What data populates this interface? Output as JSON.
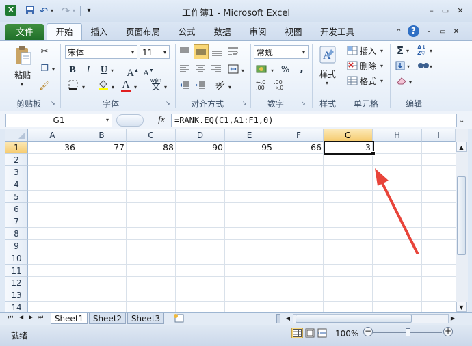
{
  "title": "工作簿1 - Microsoft Excel",
  "window": {
    "minimize": "–",
    "restore": "▭",
    "close": "✕"
  },
  "quick_access": {
    "undo": "↶",
    "redo": "↷",
    "customize": "▾"
  },
  "tabs": [
    {
      "label": "文件"
    },
    {
      "label": "开始"
    },
    {
      "label": "插入"
    },
    {
      "label": "页面布局"
    },
    {
      "label": "公式"
    },
    {
      "label": "数据"
    },
    {
      "label": "审阅"
    },
    {
      "label": "视图"
    },
    {
      "label": "开发工具"
    }
  ],
  "ribbon": {
    "clipboard": {
      "label": "剪贴板",
      "paste": "粘贴"
    },
    "font": {
      "label": "字体",
      "name": "宋体",
      "size": "11",
      "bold": "B",
      "italic": "I",
      "underline": "U",
      "grow": "A",
      "shrink": "A",
      "font_color": "A",
      "phonetic": "wén"
    },
    "alignment": {
      "label": "对齐方式"
    },
    "number": {
      "label": "数字",
      "format": "常规",
      "percent": "%",
      "comma": ","
    },
    "styles": {
      "label": "样式",
      "button": "样式"
    },
    "cells": {
      "label": "单元格",
      "insert": "插入",
      "delete": "删除",
      "format": "格式"
    },
    "editing": {
      "label": "编辑",
      "sum": "Σ"
    }
  },
  "formula_bar": {
    "name_box": "G1",
    "fx": "fx",
    "formula": "=RANK.EQ(C1,A1:F1,0)"
  },
  "columns": [
    "A",
    "B",
    "C",
    "D",
    "E",
    "F",
    "G",
    "H",
    "I"
  ],
  "selected_column": "G",
  "rows": [
    "1",
    "2",
    "3",
    "4",
    "5",
    "6",
    "7",
    "8",
    "9",
    "10",
    "11",
    "12",
    "13",
    "14"
  ],
  "selected_row": "1",
  "cells_row1": [
    "36",
    "77",
    "88",
    "90",
    "95",
    "66",
    "3"
  ],
  "sheets": [
    "Sheet1",
    "Sheet2",
    "Sheet3"
  ],
  "active_sheet": "Sheet1",
  "status": {
    "ready": "就绪",
    "zoom": "100%"
  },
  "colors": {
    "file_tab": "#2a7a30",
    "active_cell_border": "#111111",
    "selected_header": "#f6cc71",
    "arrow": "#e8443a"
  }
}
